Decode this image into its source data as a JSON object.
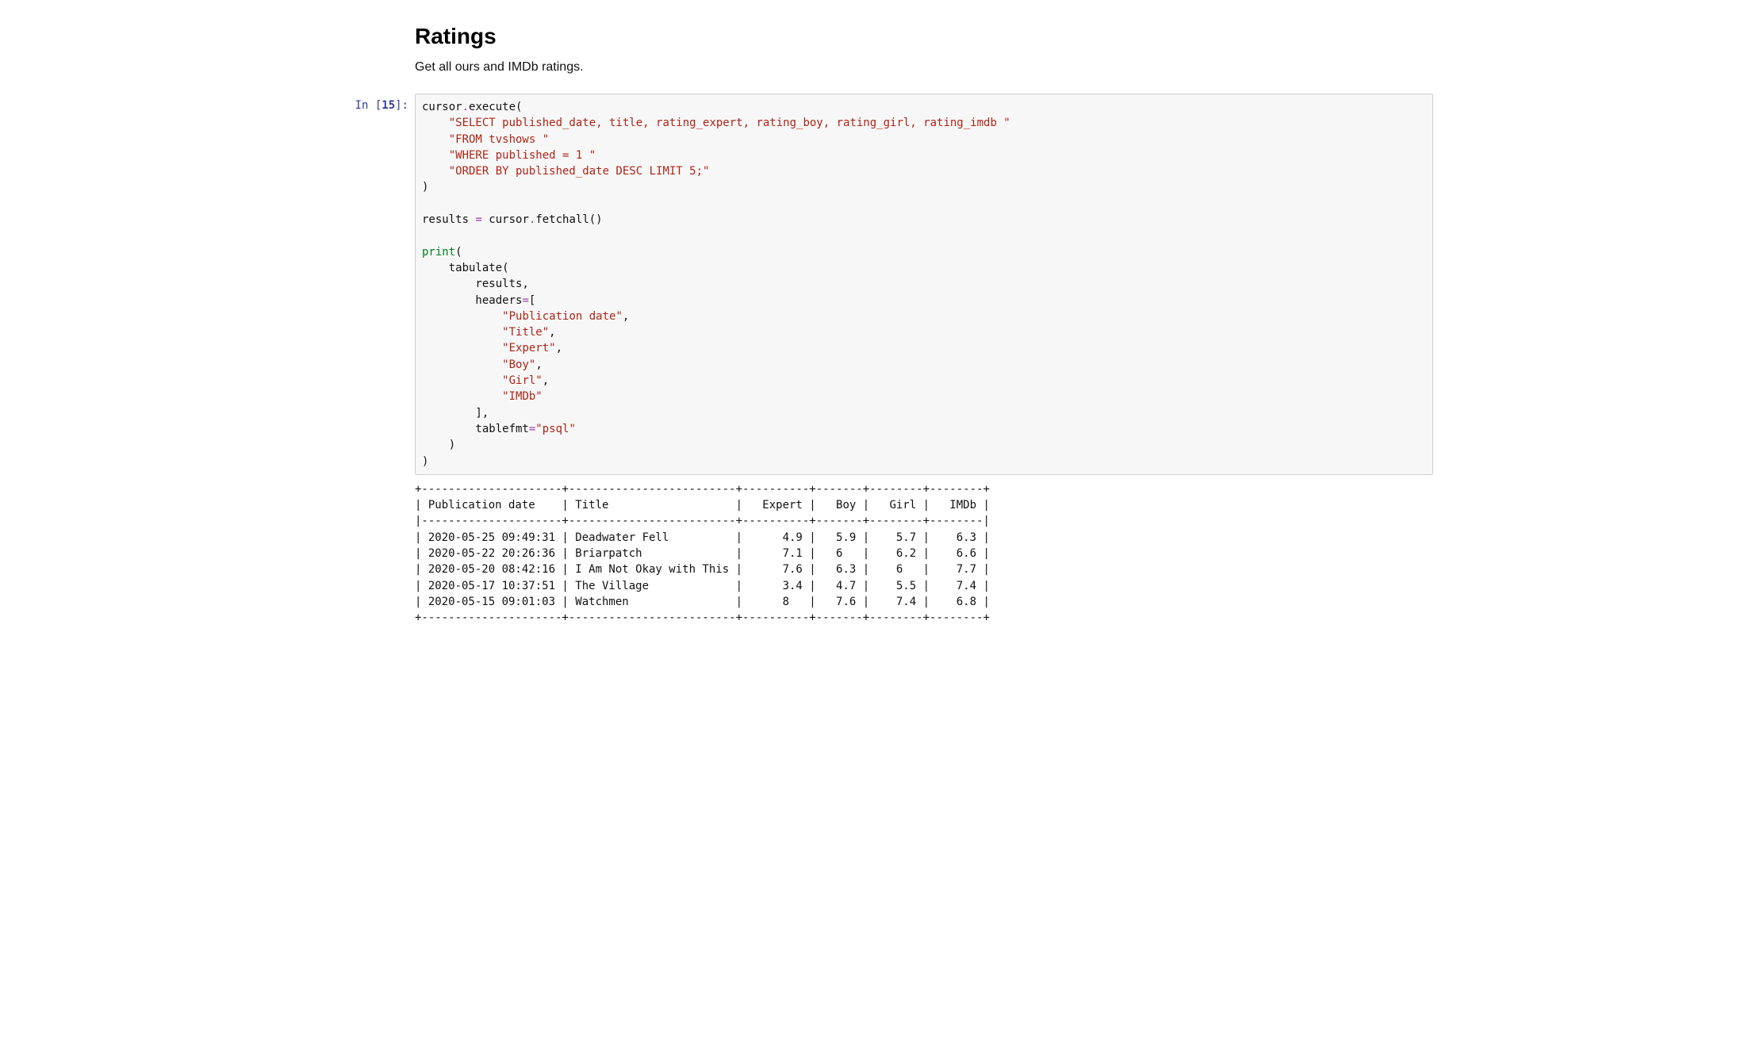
{
  "heading": "Ratings",
  "description": "Get all ours and IMDb ratings.",
  "prompt": {
    "in_label": "In [",
    "in_number": "15",
    "in_close": "]:"
  },
  "code": {
    "l01a": "cursor",
    "l01b": ".",
    "l01c": "execute(",
    "l02": "\"SELECT published_date, title, rating_expert, rating_boy, rating_girl, rating_imdb \"",
    "l03": "\"FROM tvshows \"",
    "l04": "\"WHERE published = 1 \"",
    "l05": "\"ORDER BY published_date DESC LIMIT 5;\"",
    "l06": ")",
    "l07": "",
    "l08a": "results ",
    "l08b": "=",
    "l08c": " cursor",
    "l08d": ".",
    "l08e": "fetchall()",
    "l09": "",
    "l10a": "print",
    "l10b": "(",
    "l11": "    tabulate(",
    "l12": "        results,",
    "l13a": "        headers",
    "l13b": "=",
    "l13c": "[",
    "l14": "\"Publication date\"",
    "l14b": ",",
    "l15": "\"Title\"",
    "l15b": ",",
    "l16": "\"Expert\"",
    "l16b": ",",
    "l17": "\"Boy\"",
    "l17b": ",",
    "l18": "\"Girl\"",
    "l18b": ",",
    "l19": "\"IMDb\"",
    "l20": "        ],",
    "l21a": "        tablefmt",
    "l21b": "=",
    "l21c": "\"psql\"",
    "l22": "    )",
    "l23": ")"
  },
  "output": "+---------------------+-------------------------+----------+-------+--------+--------+\n| Publication date    | Title                   |   Expert |   Boy |   Girl |   IMDb |\n|---------------------+-------------------------+----------+-------+--------+--------|\n| 2020-05-25 09:49:31 | Deadwater Fell          |      4.9 |   5.9 |    5.7 |    6.3 |\n| 2020-05-22 20:26:36 | Briarpatch              |      7.1 |   6   |    6.2 |    6.6 |\n| 2020-05-20 08:42:16 | I Am Not Okay with This |      7.6 |   6.3 |    6   |    7.7 |\n| 2020-05-17 10:37:51 | The Village             |      3.4 |   4.7 |    5.5 |    7.4 |\n| 2020-05-15 09:01:03 | Watchmen                |      8   |   7.6 |    7.4 |    6.8 |\n+---------------------+-------------------------+----------+-------+--------+--------+",
  "chart_data": {
    "type": "table",
    "columns": [
      "Publication date",
      "Title",
      "Expert",
      "Boy",
      "Girl",
      "IMDb"
    ],
    "rows": [
      [
        "2020-05-25 09:49:31",
        "Deadwater Fell",
        4.9,
        5.9,
        5.7,
        6.3
      ],
      [
        "2020-05-22 20:26:36",
        "Briarpatch",
        7.1,
        6,
        6.2,
        6.6
      ],
      [
        "2020-05-20 08:42:16",
        "I Am Not Okay with This",
        7.6,
        6.3,
        6,
        7.7
      ],
      [
        "2020-05-17 10:37:51",
        "The Village",
        3.4,
        4.7,
        5.5,
        7.4
      ],
      [
        "2020-05-15 09:01:03",
        "Watchmen",
        8,
        7.6,
        7.4,
        6.8
      ]
    ]
  }
}
